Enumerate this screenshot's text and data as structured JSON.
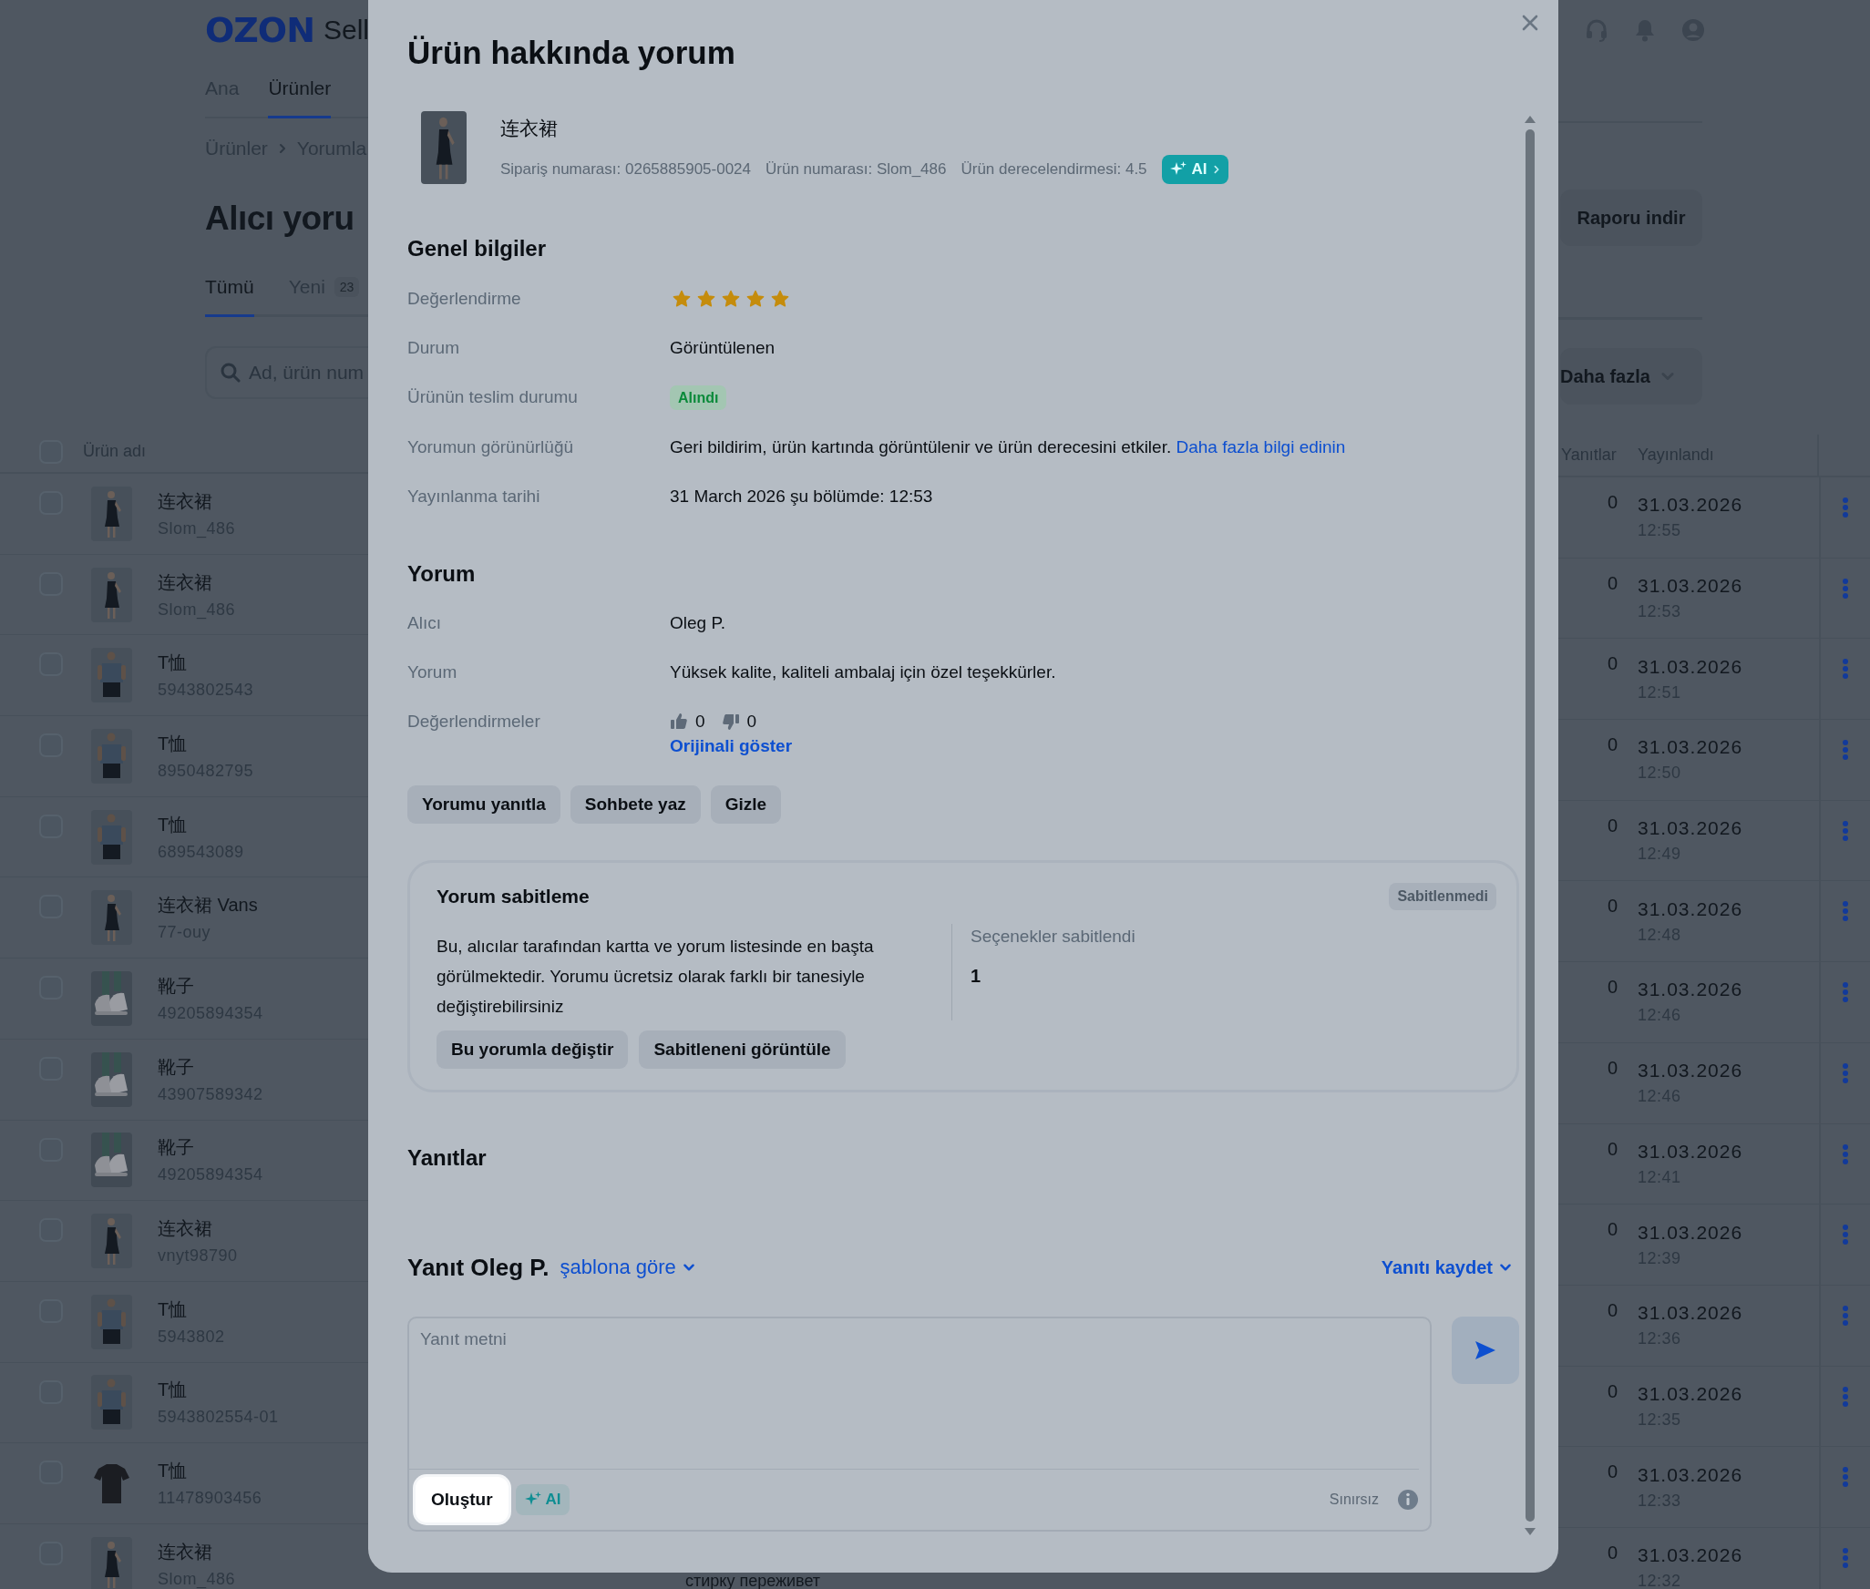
{
  "background_page": {
    "logo": "OZON",
    "logo_suffix": "Sell",
    "nav": [
      {
        "label": "Ana",
        "selected": false
      },
      {
        "label": "Ürünler",
        "selected": true
      }
    ],
    "breadcrumb": [
      "Ürünler",
      "Yorumla"
    ],
    "title": "Alıcı yoru",
    "tabs": [
      {
        "label": "Tümü",
        "selected": true
      },
      {
        "label": "Yeni",
        "count": "23",
        "selected": false
      }
    ],
    "search": {
      "placeholder": "Ad, ürün num"
    },
    "report_button": "Raporu indir",
    "more_button": "Daha fazla",
    "table": {
      "columns": [
        "Ürün adı",
        "Yanıtlar",
        "Yayınlandı"
      ],
      "select_all_checked": false,
      "rows": [
        {
          "name": "连衣裙",
          "sku": "Slom_486",
          "replies": "0",
          "date": "31.03.2026",
          "time": "12:55",
          "checked": false
        },
        {
          "name": "连衣裙",
          "sku": "Slom_486",
          "replies": "0",
          "date": "31.03.2026",
          "time": "12:53",
          "checked": false
        },
        {
          "name": "T恤",
          "sku": "5943802543",
          "replies": "0",
          "date": "31.03.2026",
          "time": "12:51",
          "checked": false
        },
        {
          "name": "T恤",
          "sku": "8950482795",
          "replies": "0",
          "date": "31.03.2026",
          "time": "12:50",
          "checked": false
        },
        {
          "name": "T恤",
          "sku": "689543089",
          "replies": "0",
          "date": "31.03.2026",
          "time": "12:49",
          "checked": false
        },
        {
          "name": "连衣裙 Vans",
          "sku": "77-ouy",
          "replies": "0",
          "date": "31.03.2026",
          "time": "12:48",
          "checked": false
        },
        {
          "name": "靴子",
          "sku": "49205894354",
          "replies": "0",
          "date": "31.03.2026",
          "time": "12:46",
          "checked": false
        },
        {
          "name": "靴子",
          "sku": "43907589342",
          "replies": "0",
          "date": "31.03.2026",
          "time": "12:46",
          "checked": false
        },
        {
          "name": "靴子",
          "sku": "49205894354",
          "replies": "0",
          "date": "31.03.2026",
          "time": "12:41",
          "checked": false
        },
        {
          "name": "连衣裙",
          "sku": "vnyt98790",
          "replies": "0",
          "date": "31.03.2026",
          "time": "12:39",
          "checked": false
        },
        {
          "name": "T恤",
          "sku": "5943802",
          "replies": "0",
          "date": "31.03.2026",
          "time": "12:36",
          "checked": false
        },
        {
          "name": "T恤",
          "sku": "5943802554-01",
          "replies": "0",
          "date": "31.03.2026",
          "time": "12:35",
          "checked": false
        },
        {
          "name": "T恤",
          "sku": "11478903456",
          "replies": "0",
          "date": "31.03.2026",
          "time": "12:33",
          "checked": false
        },
        {
          "name": "连衣裙",
          "sku": "Slom_486",
          "replies": "0",
          "date": "31.03.2026",
          "time": "12:32",
          "checked": false
        }
      ]
    },
    "bottom_snippet": "стирку переживет"
  },
  "modal": {
    "title": "Ürün hakkında yorum",
    "product": {
      "name": "连衣裙",
      "order_number": "Sipariş numarası: 0265885905-0024",
      "product_number": "Ürün numarası: Slom_486",
      "product_rating": "Ürün derecelendirmesi: 4.5",
      "ai_button": "AI"
    },
    "general": {
      "heading": "Genel bilgiler",
      "rows": [
        {
          "label": "Değerlendirme",
          "kind": "stars",
          "stars": 5
        },
        {
          "label": "Durum",
          "kind": "text",
          "value": "Görüntülenen"
        },
        {
          "label": "Ürünün teslim durumu",
          "kind": "badge",
          "value": "Alındı"
        },
        {
          "label": "Yorumun görünürlüğü",
          "kind": "text_link",
          "value": "Geri bildirim, ürün kartında görüntülenir ve ürün derecesini etkiler.",
          "link": "Daha fazla bilgi edinin"
        },
        {
          "label": "Yayınlanma tarihi",
          "kind": "text",
          "value": "31 March 2026 şu bölümde: 12:53"
        }
      ]
    },
    "review": {
      "heading": "Yorum",
      "rows": [
        {
          "label": "Alıcı",
          "kind": "text",
          "value": "Oleg P."
        },
        {
          "label": "Yorum",
          "kind": "text",
          "value": "Yüksek kalite, kaliteli ambalaj için özel teşekkürler."
        },
        {
          "label": "Değerlendirmeler",
          "kind": "votes",
          "likes": "0",
          "dislikes": "0",
          "link": "Orijinali göster"
        }
      ],
      "actions": [
        "Yorumu yanıtla",
        "Sohbete yaz",
        "Gizle"
      ]
    },
    "pin": {
      "title": "Yorum sabitleme",
      "status": "Sabitlenmedi",
      "description": "Bu, alıcılar tarafından kartta ve yorum listesinde en başta görülmektedir. Yorumu ücretsiz olarak farklı bir tanesiyle değiştirebilirsiniz",
      "stat_label": "Seçenekler sabitlendi",
      "stat_value": "1",
      "actions": [
        "Bu yorumla değiştir",
        "Sabitleneni görüntüle"
      ]
    },
    "replies": {
      "heading": "Yanıtlar"
    },
    "reply_form": {
      "title": "Yanıt Oleg P.",
      "template_link": "şablona göre",
      "save_link": "Yanıtı kaydet",
      "placeholder": "Yanıt metni",
      "generate_button": "Oluştur",
      "ai_button": "AI",
      "limit": "Sınırsız"
    }
  }
}
